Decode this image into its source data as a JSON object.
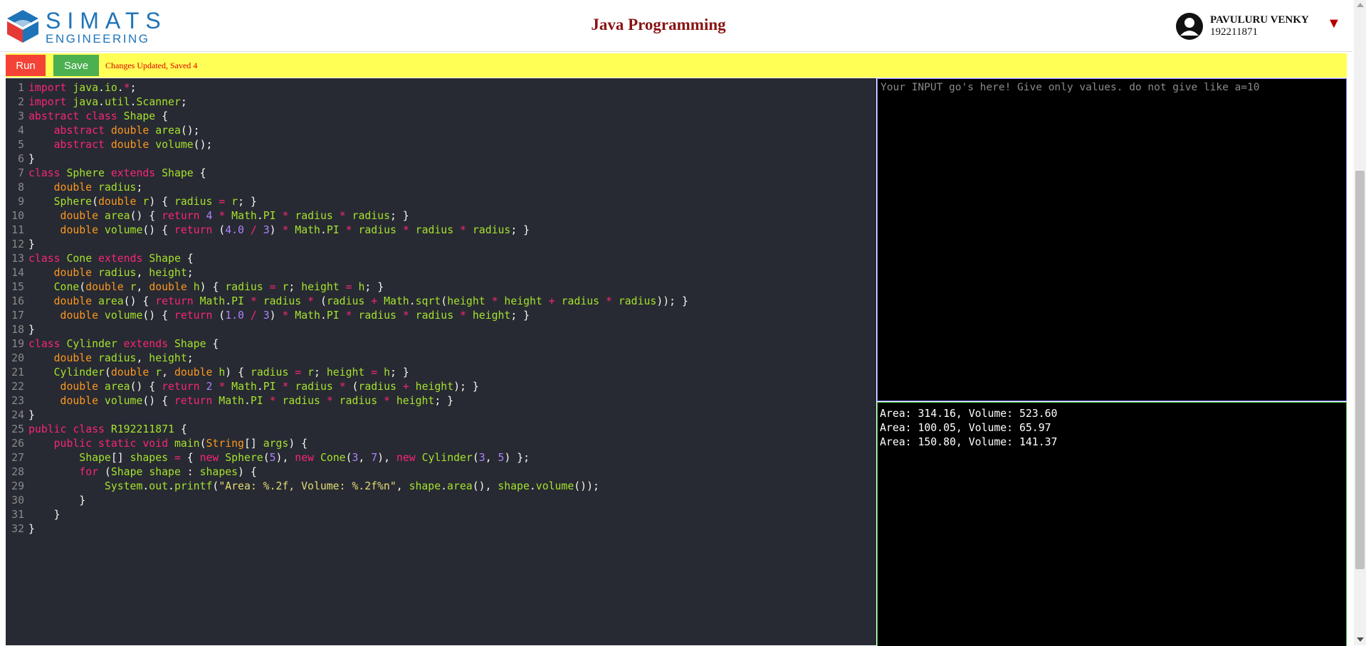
{
  "header": {
    "logo": {
      "line1": "SIMATS",
      "line2": "ENGINEERING"
    },
    "title": "Java Programming",
    "user": {
      "name": "PAVULURU VENKY",
      "id": "192211871",
      "dropdown_icon": "caret-down-icon"
    }
  },
  "toolbar": {
    "run_label": "Run",
    "save_label": "Save",
    "status": "Changes Updated, Saved 4",
    "colors": {
      "run": "#f44336",
      "save": "#4caf50",
      "bar": "#ffff55"
    }
  },
  "editor": {
    "lines": [
      "import java.io.*;",
      "import java.util.Scanner;",
      "abstract class Shape {",
      "    abstract double area();",
      "    abstract double volume();",
      "}",
      "class Sphere extends Shape {",
      "    double radius;",
      "    Sphere(double r) { radius = r; }",
      "     double area() { return 4 * Math.PI * radius * radius; }",
      "     double volume() { return (4.0 / 3) * Math.PI * radius * radius * radius; }",
      "}",
      "class Cone extends Shape {",
      "    double radius, height;",
      "    Cone(double r, double h) { radius = r; height = h; }",
      "    double area() { return Math.PI * radius * (radius + Math.sqrt(height * height + radius * radius)); }",
      "     double volume() { return (1.0 / 3) * Math.PI * radius * radius * height; }",
      "}",
      "class Cylinder extends Shape {",
      "    double radius, height;",
      "    Cylinder(double r, double h) { radius = r; height = h; }",
      "     double area() { return 2 * Math.PI * radius * (radius + height); }",
      "     double volume() { return Math.PI * radius * radius * height; }",
      "}",
      "public class R192211871 {",
      "    public static void main(String[] args) {",
      "        Shape[] shapes = { new Sphere(5), new Cone(3, 7), new Cylinder(3, 5) };",
      "        for (Shape shape : shapes) {",
      "            System.out.printf(\"Area: %.2f, Volume: %.2f%n\", shape.area(), shape.volume());",
      "        }",
      "    }",
      "}"
    ]
  },
  "input": {
    "placeholder": "Your INPUT go's here! Give only values. do not give like a=10",
    "value": ""
  },
  "output": {
    "lines": [
      "Area: 314.16, Volume: 523.60",
      "Area: 100.05, Volume: 65.97",
      "Area: 150.80, Volume: 141.37"
    ]
  }
}
